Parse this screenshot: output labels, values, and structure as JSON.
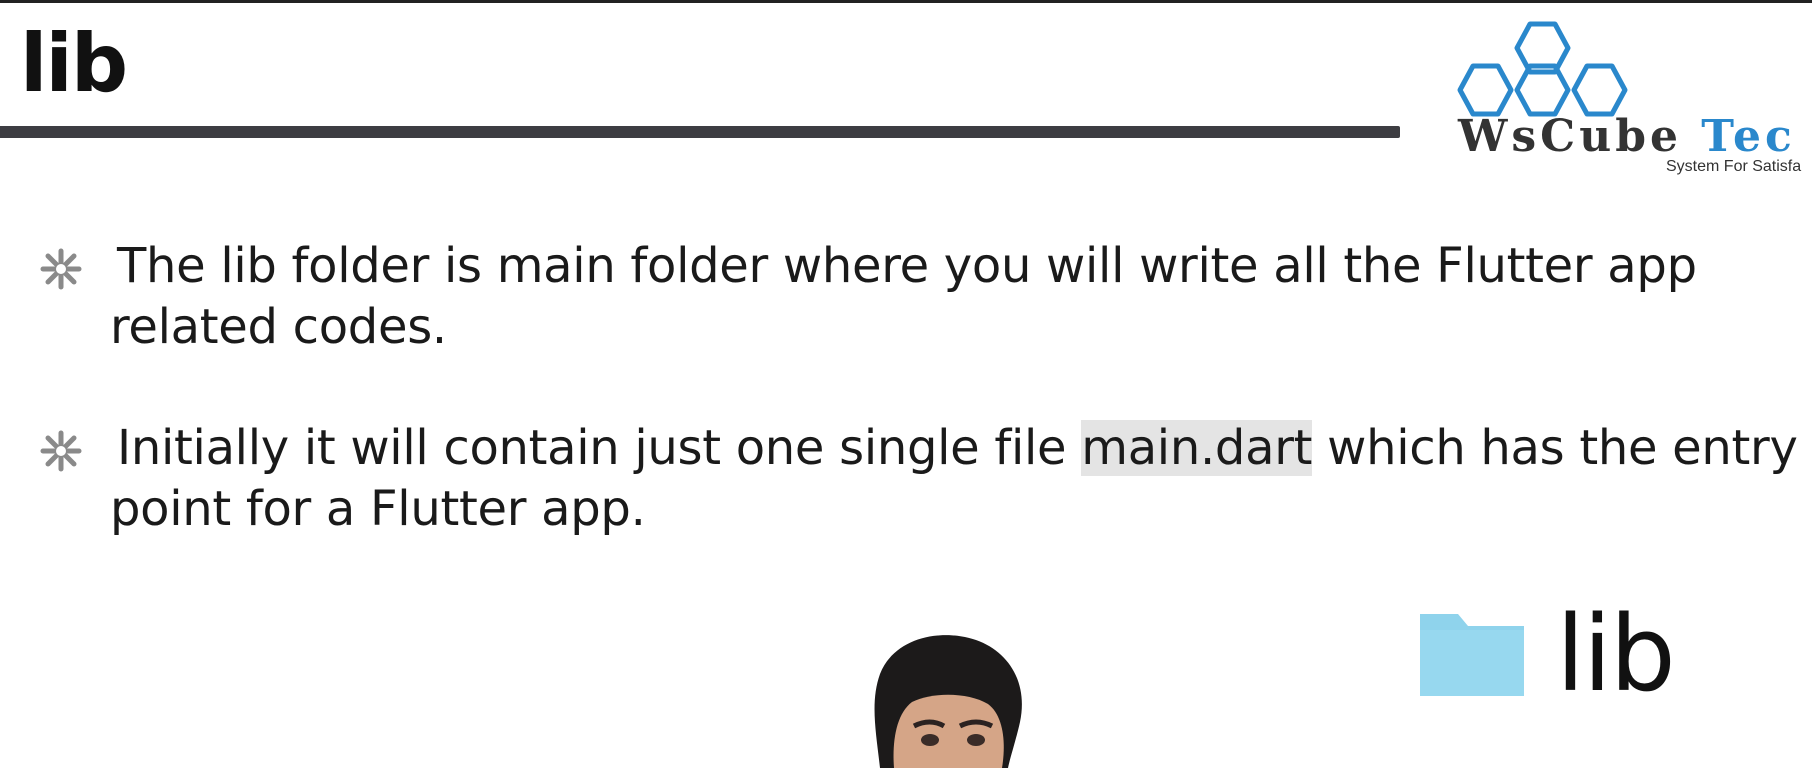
{
  "slide": {
    "title": "lib"
  },
  "logo": {
    "name_part1": "WsCube ",
    "name_part2": "Tec",
    "tagline": "System For Satisfa"
  },
  "bullets": [
    {
      "text_before": "The lib folder is main folder where you will write all the Flutter app related codes."
    },
    {
      "text_before": "Initially it will contain just one single file ",
      "highlight": "main.dart",
      "text_after": " which has the entry point for a Flutter app."
    }
  ],
  "bullet_icon": "asterisk-bullet-icon",
  "folder": {
    "icon": "folder-icon",
    "label": "lib",
    "color": "#8fd3ec"
  },
  "colors": {
    "logo_blue": "#2a88cc",
    "underline": "#3d3d42"
  }
}
